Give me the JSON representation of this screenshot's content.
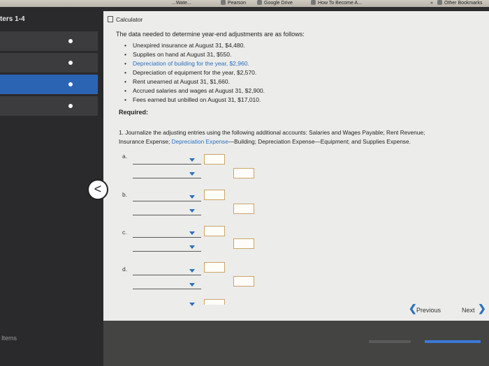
{
  "bookmarks": {
    "items": [
      {
        "label": "...Wate..."
      },
      {
        "label": "Pearson"
      },
      {
        "label": "Google Drive"
      },
      {
        "label": "How To Become A..."
      },
      {
        "label": "»"
      },
      {
        "label": "Other Bookmarks"
      }
    ]
  },
  "nav": {
    "chapter": "ters 1-4",
    "items_label": "Items"
  },
  "calculator": {
    "label": "Calculator"
  },
  "problem": {
    "intro": "The data needed to determine year-end adjustments are as follows:",
    "facts": [
      "Unexpired insurance at August 31, $4,480.",
      "Supplies on hand at August 31, $550.",
      "Depreciation of building for the year, $2,960.",
      "Depreciation of equipment for the year, $2,570.",
      "Rent unearned at August 31, $1,660.",
      "Accrued salaries and wages at August 31, $2,900.",
      "Fees earned but unbilled on August 31, $17,010."
    ],
    "required": "Required:",
    "question_prefix": "1. Journalize the adjusting entries using the following additional accounts: Salaries and Wages Payable; Rent Revenue;",
    "question_line2_a": "Insurance Expense; ",
    "question_line2_link": "Depreciation Expense",
    "question_line2_b": "—Building; Depreciation Expense—Equipment; and Supplies Expense.",
    "entries": [
      "a.",
      "b.",
      "c.",
      "d."
    ]
  },
  "navigation": {
    "back": "<",
    "previous": "Previous",
    "next": "Next"
  },
  "colors": {
    "accent": "#2a6fbf",
    "active_nav": "#2c64b4"
  }
}
